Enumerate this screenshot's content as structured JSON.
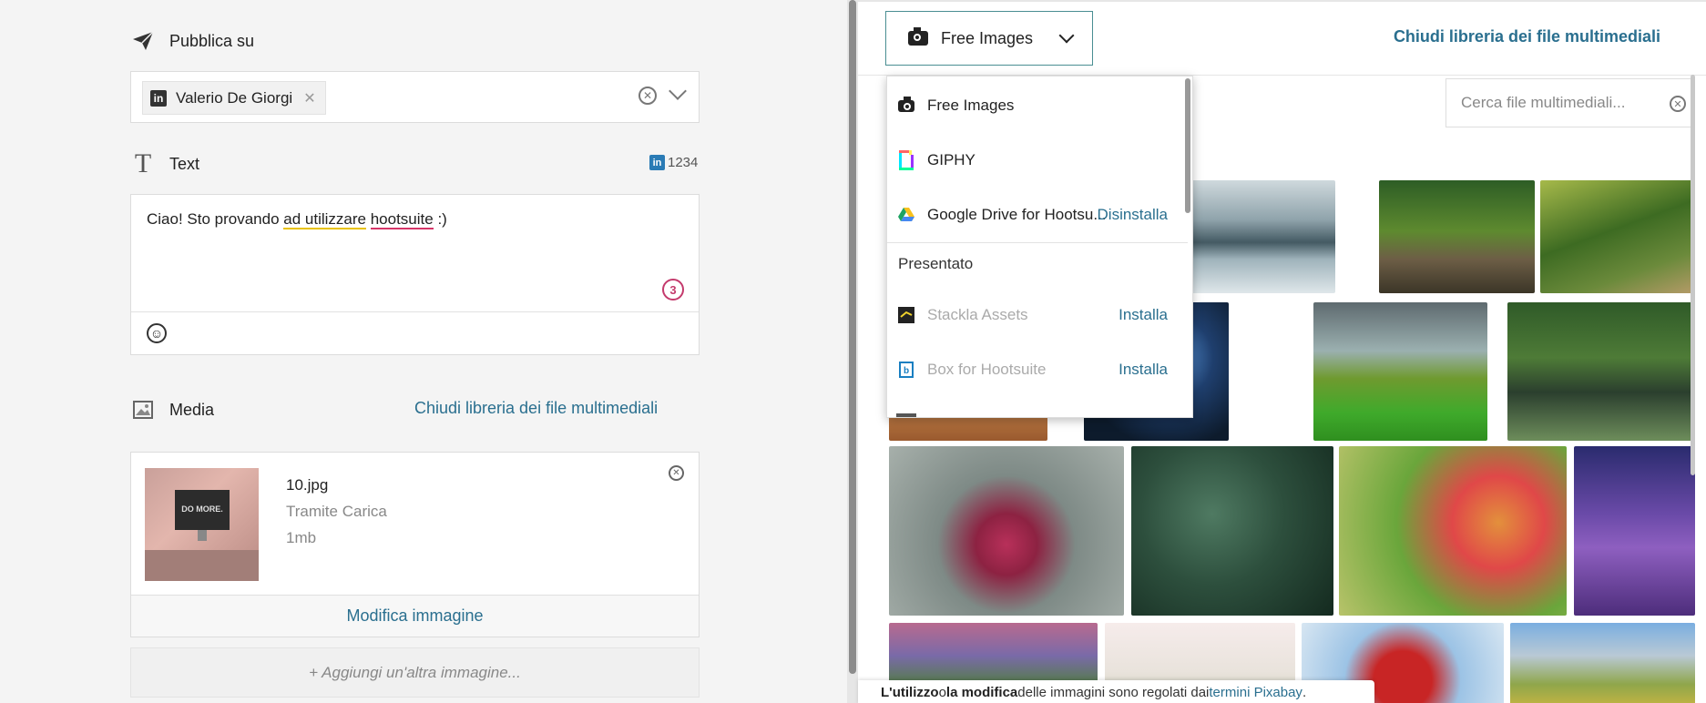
{
  "left": {
    "publish": {
      "label": "Pubblica su",
      "profile": "Valerio De Giorgi",
      "profile_network": "in"
    },
    "text": {
      "label": "Text",
      "counter_network": "in",
      "counter": "1234",
      "content_plain": "Ciao! Sto provando ",
      "content_u1": "ad utilizzare",
      "content_space": " ",
      "content_u2": "hootsuite",
      "content_tail": " :)",
      "error_count": "3"
    },
    "media": {
      "label": "Media",
      "close_library": "Chiudi libreria dei file multimediali",
      "thumb_text": "DO MORE.",
      "file_name": "10.jpg",
      "file_source": "Tramite Carica",
      "file_size": "1mb",
      "edit": "Modifica immagine",
      "add_more": "+ Aggiungi un'altra immagine..."
    }
  },
  "right": {
    "source_select": "Free Images",
    "close_library": "Chiudi libreria dei file multimediali",
    "search_placeholder": "Cerca file multimediali...",
    "dropdown": {
      "items": [
        {
          "label": "Free Images",
          "icon": "camera-icon"
        },
        {
          "label": "GIPHY",
          "icon": "giphy-icon"
        },
        {
          "label": "Google Drive for Hootsu...",
          "icon": "google-drive-icon",
          "action": "Disinstalla"
        }
      ],
      "section_label": "Presentato",
      "featured": [
        {
          "label": "Stackla Assets",
          "icon": "stackla-icon",
          "action": "Installa"
        },
        {
          "label": "Box for Hootsuite",
          "icon": "box-icon",
          "action": "Installa"
        }
      ]
    },
    "footer": {
      "part1": "L'utilizzo",
      "part2": " o ",
      "part3": "la modifica",
      "part4": " delle immagini sono regolati dai ",
      "link": "termini Pixabay",
      "end": "."
    }
  },
  "colors": {
    "accent": "#2a6f8f",
    "linkedin": "#2a7bb5",
    "error": "#c43a6c"
  }
}
